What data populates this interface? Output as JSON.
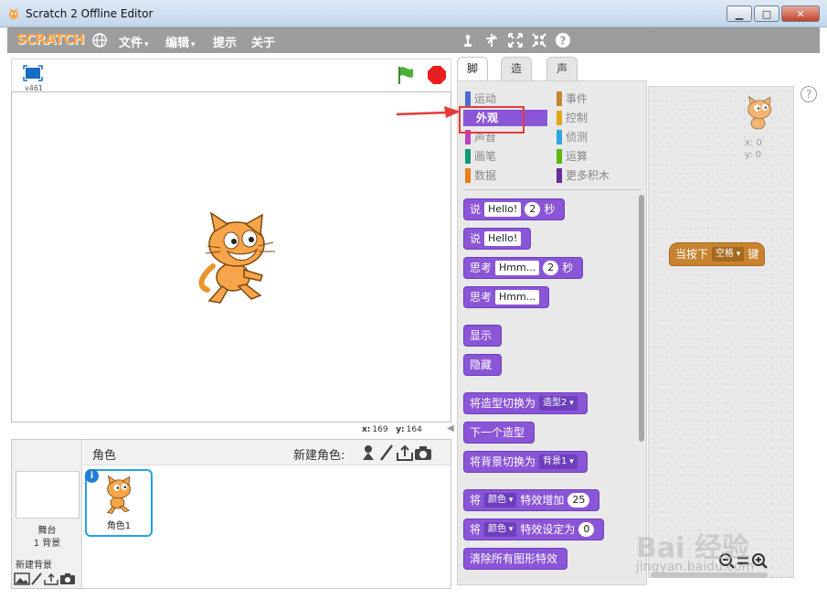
{
  "window": {
    "title": "Scratch 2 Offline Editor"
  },
  "menubar": {
    "logo": "SCRATCH",
    "items": [
      {
        "label": "文件",
        "caret": "▾"
      },
      {
        "label": "编辑",
        "caret": "▾"
      },
      {
        "label": "提示",
        "caret": ""
      },
      {
        "label": "关于",
        "caret": ""
      }
    ],
    "tool_icons": [
      "duplicate-icon",
      "delete-icon",
      "grow-icon",
      "shrink-icon",
      "help-icon"
    ]
  },
  "stage": {
    "version": "v461",
    "mouse": {
      "x_label": "x:",
      "x": "169",
      "y_label": "y:",
      "y": "164"
    }
  },
  "sprites": {
    "title": "角色",
    "new_sprite_label": "新建角色:",
    "stage_label": "舞台",
    "stage_backdrops": "1 背景",
    "new_backdrop_label": "新建背景",
    "items": [
      {
        "name": "角色1"
      }
    ]
  },
  "tabs": [
    {
      "label": "脚本"
    },
    {
      "label": "造型"
    },
    {
      "label": "声音"
    }
  ],
  "categories": {
    "left": [
      {
        "label": "运动",
        "color": "#4a6cd4"
      },
      {
        "label": "外观",
        "color": "#8a55d7"
      },
      {
        "label": "声音",
        "color": "#bb42c3"
      },
      {
        "label": "画笔",
        "color": "#0e9a6c"
      },
      {
        "label": "数据",
        "color": "#ee7d16"
      }
    ],
    "right": [
      {
        "label": "事件",
        "color": "#c88330"
      },
      {
        "label": "控制",
        "color": "#e1a91a"
      },
      {
        "label": "侦测",
        "color": "#2ca5e2"
      },
      {
        "label": "运算",
        "color": "#5cb712"
      },
      {
        "label": "更多积木",
        "color": "#632d99"
      }
    ],
    "selected": "外观"
  },
  "blocks": {
    "say_secs": {
      "t1": "说",
      "v1": "Hello!",
      "v2": "2",
      "t2": "秒"
    },
    "say": {
      "t1": "说",
      "v1": "Hello!"
    },
    "think_secs": {
      "t1": "思考",
      "v1": "Hmm...",
      "v2": "2",
      "t2": "秒"
    },
    "think": {
      "t1": "思考",
      "v1": "Hmm..."
    },
    "show": {
      "t1": "显示"
    },
    "hide": {
      "t1": "隐藏"
    },
    "switch_costume": {
      "t1": "将造型切换为",
      "v1": "造型2"
    },
    "next_costume": {
      "t1": "下一个造型"
    },
    "switch_backdrop": {
      "t1": "将背景切换为",
      "v1": "背景1"
    },
    "change_effect": {
      "t1": "将",
      "v1": "颜色",
      "t2": "特效增加",
      "v2": "25"
    },
    "set_effect": {
      "t1": "将",
      "v1": "颜色",
      "t2": "特效设定为",
      "v2": "0"
    },
    "clear_effects": {
      "t1": "清除所有图形特效"
    }
  },
  "scripts": {
    "sprite_x": "x: 0",
    "sprite_y": "y: 0",
    "hat": {
      "t1": "当按下",
      "v1": "空格",
      "t2": "键"
    },
    "help": "?"
  },
  "watermark": {
    "main": "Bai 经验",
    "sub": "jingyan.baidu.com"
  },
  "colors": {
    "looks": "#8a55d7",
    "events": "#c88330",
    "annotation": "#e53b3b"
  }
}
